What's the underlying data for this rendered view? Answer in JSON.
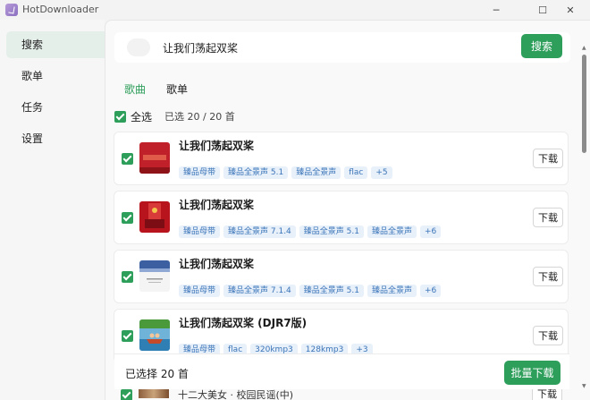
{
  "window": {
    "title": "HotDownloader",
    "minimize": "─",
    "maximize": "☐",
    "close": "✕"
  },
  "sidebar": {
    "items": [
      {
        "label": "搜索",
        "active": true
      },
      {
        "label": "歌单",
        "active": false
      },
      {
        "label": "任务",
        "active": false
      },
      {
        "label": "设置",
        "active": false
      }
    ]
  },
  "search": {
    "value": "让我们荡起双桨",
    "button": "搜索"
  },
  "tabs": [
    {
      "label": "歌曲",
      "active": true
    },
    {
      "label": "歌单",
      "active": false
    }
  ],
  "selection": {
    "select_all_label": "全选",
    "count_text": "已选 20 / 20 首"
  },
  "songs": [
    {
      "title": "让我们荡起双桨",
      "tags": [
        "臻品母带",
        "臻品全景声 5.1",
        "臻品全景声",
        "flac",
        "+5"
      ],
      "download": "下载",
      "checked": true
    },
    {
      "title": "让我们荡起双桨",
      "tags": [
        "臻品母带",
        "臻品全景声 7.1.4",
        "臻品全景声 5.1",
        "臻品全景声",
        "+6"
      ],
      "download": "下载",
      "checked": true
    },
    {
      "title": "让我们荡起双桨",
      "tags": [
        "臻品母带",
        "臻品全景声 7.1.4",
        "臻品全景声 5.1",
        "臻品全景声",
        "+6"
      ],
      "download": "下载",
      "checked": true
    },
    {
      "title": "让我们荡起双桨 (DJR7版)",
      "tags": [
        "臻品母带",
        "flac",
        "320kmp3",
        "128kmp3",
        "+3"
      ],
      "download": "下载",
      "checked": true
    }
  ],
  "peek_song": {
    "title": "十二大美女 · 校园民谣(中)",
    "download": "下载"
  },
  "bottom": {
    "selected_text": "已选择 20 首",
    "batch_button": "批量下载"
  },
  "colors": {
    "accent": "#2e9e5b",
    "tag_text": "#3a74b8",
    "tag_bg": "#e8f0fa"
  }
}
